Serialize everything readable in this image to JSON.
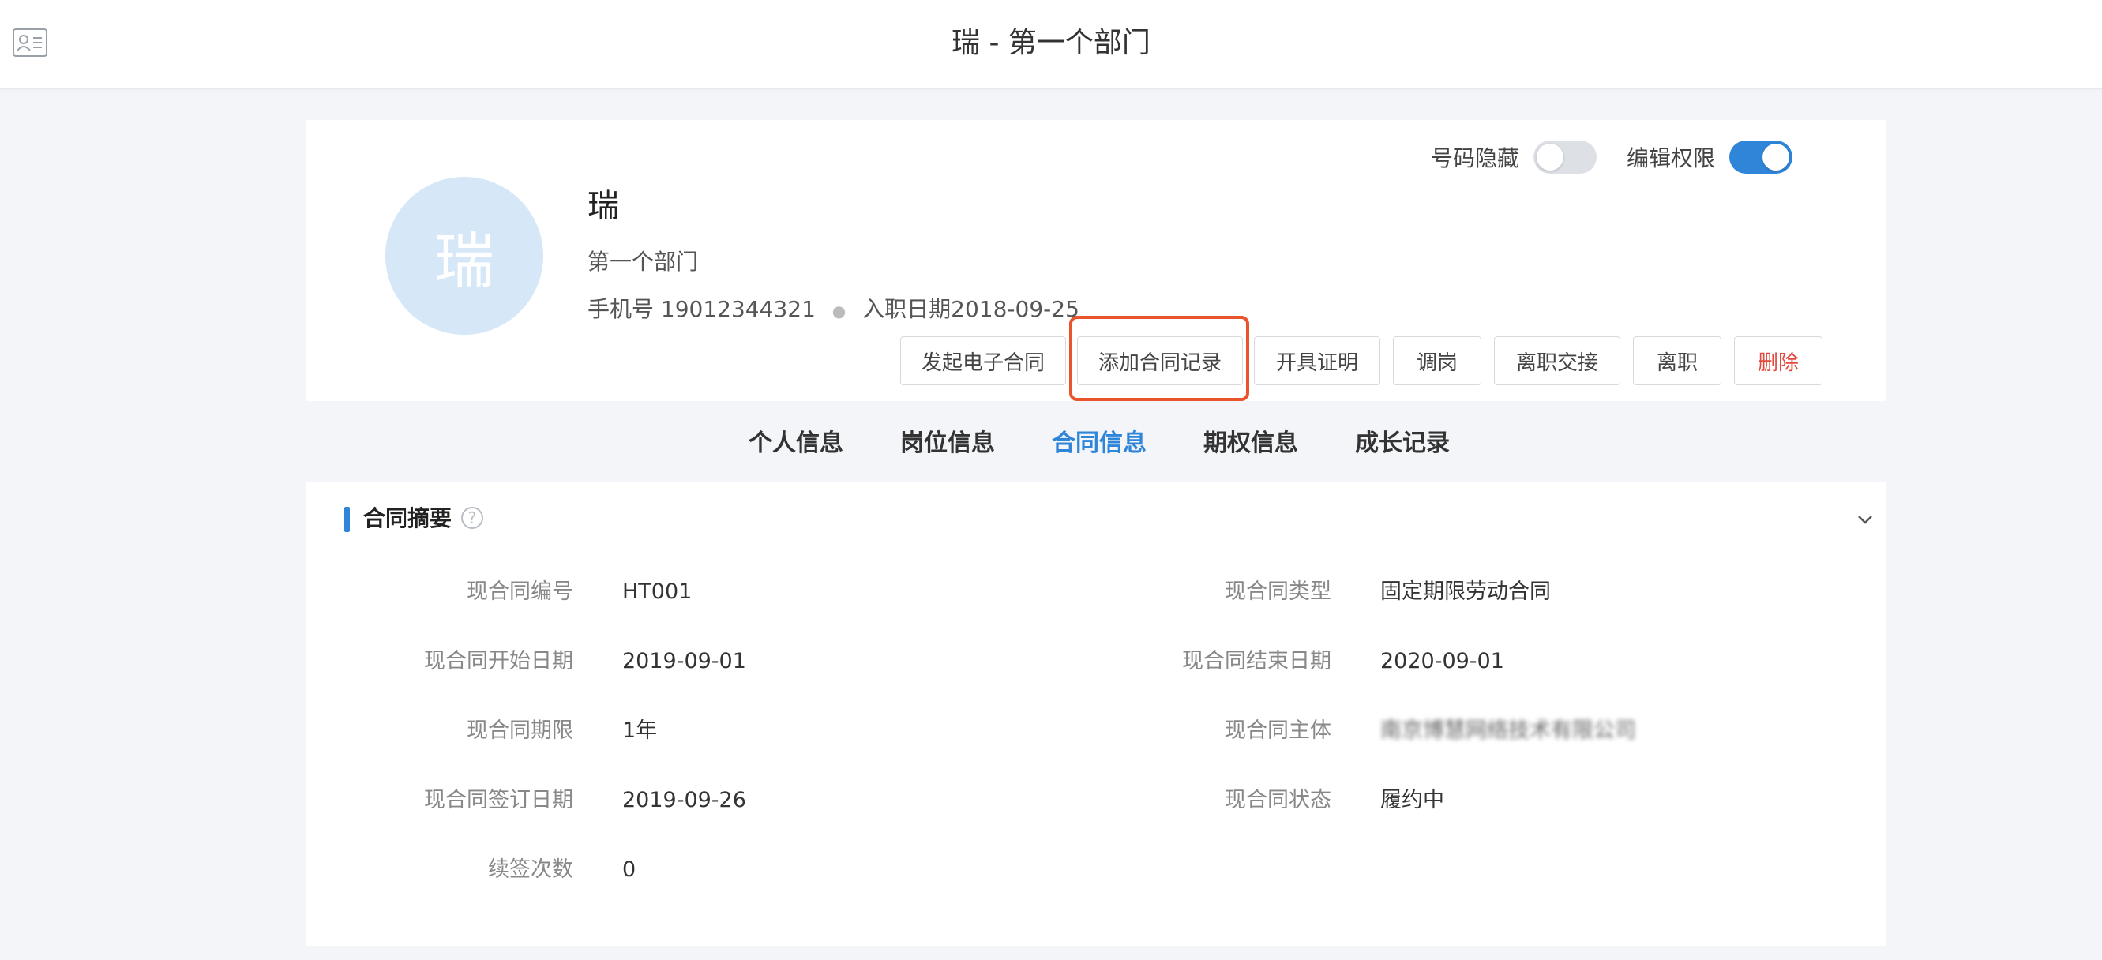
{
  "header": {
    "title": "瑞 - 第一个部门",
    "icon": "id-card-icon"
  },
  "profile": {
    "avatar_text": "瑞",
    "name": "瑞",
    "department": "第一个部门",
    "phone_label": "手机号",
    "phone": "19012344321",
    "join_label": "入职日期",
    "join_date": "2018-09-25",
    "toggles": [
      {
        "label": "号码隐藏",
        "on": false
      },
      {
        "label": "编辑权限",
        "on": true
      }
    ],
    "actions": [
      "发起电子合同",
      "添加合同记录",
      "开具证明",
      "调岗",
      "离职交接",
      "离职",
      "删除"
    ]
  },
  "tabs": [
    "个人信息",
    "岗位信息",
    "合同信息",
    "期权信息",
    "成长记录"
  ],
  "active_tab": "合同信息",
  "summary": {
    "title": "合同摘要",
    "left": [
      {
        "label": "现合同编号",
        "value": "HT001"
      },
      {
        "label": "现合同开始日期",
        "value": "2019-09-01"
      },
      {
        "label": "现合同期限",
        "value": "1年"
      },
      {
        "label": "现合同签订日期",
        "value": "2019-09-26"
      },
      {
        "label": "续签次数",
        "value": "0"
      }
    ],
    "right": [
      {
        "label": "现合同类型",
        "value": "固定期限劳动合同"
      },
      {
        "label": "现合同结束日期",
        "value": "2020-09-01"
      },
      {
        "label": "现合同主体",
        "value": "南京博慧网络技术有限公司"
      },
      {
        "label": "现合同状态",
        "value": "履约中"
      }
    ]
  },
  "colors": {
    "accent": "#2f86d8",
    "danger": "#e4493f",
    "highlight": "#e9542c"
  }
}
